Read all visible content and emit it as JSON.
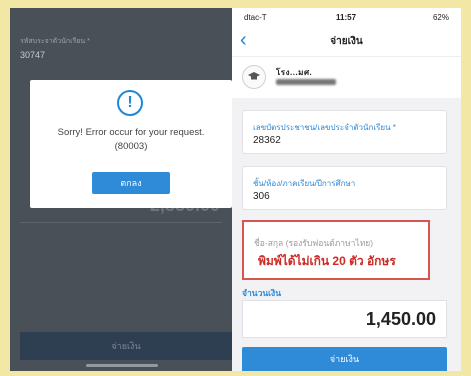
{
  "left_phone": {
    "field_label": "รหัสบระจาตัวนักเรียน *",
    "field_value": "30747",
    "amount": "2,850.00",
    "pay_button": "จ่ายเงิน",
    "dialog": {
      "icon": "!",
      "message_line1": "Sorry! Error occur for your request.",
      "message_line2": "(80003)",
      "button": "ตกลง"
    }
  },
  "right_phone": {
    "status": {
      "carrier": "dtac-T",
      "time": "11:57",
      "battery": "62%"
    },
    "header": {
      "back": "‹",
      "title": "จ่ายเงิน"
    },
    "profile": {
      "name": "โรง...มศ."
    },
    "id_field": {
      "label": "เลขบัตรประชาชน/เลขประจำตัวนักเรียน *",
      "value": "28362"
    },
    "class_field": {
      "label": "ชั้น/ห้อง/ภาคเรียน/ปีการศึกษา",
      "value": "306"
    },
    "name_field": {
      "placeholder": "ชื่อ-สกุล (รองรับฟอนต์ภาษาไทย)",
      "note": "พิมพ์ได้ไม่เกิน 20 ตัว อักษร"
    },
    "amount_label": "จำนวนเงิน",
    "amount_value": "1,450.00",
    "pay_button": "จ่ายเงิน"
  },
  "colors": {
    "accent": "#2f8ad8",
    "error": "#d9534f",
    "background": "#f3e7a6"
  }
}
